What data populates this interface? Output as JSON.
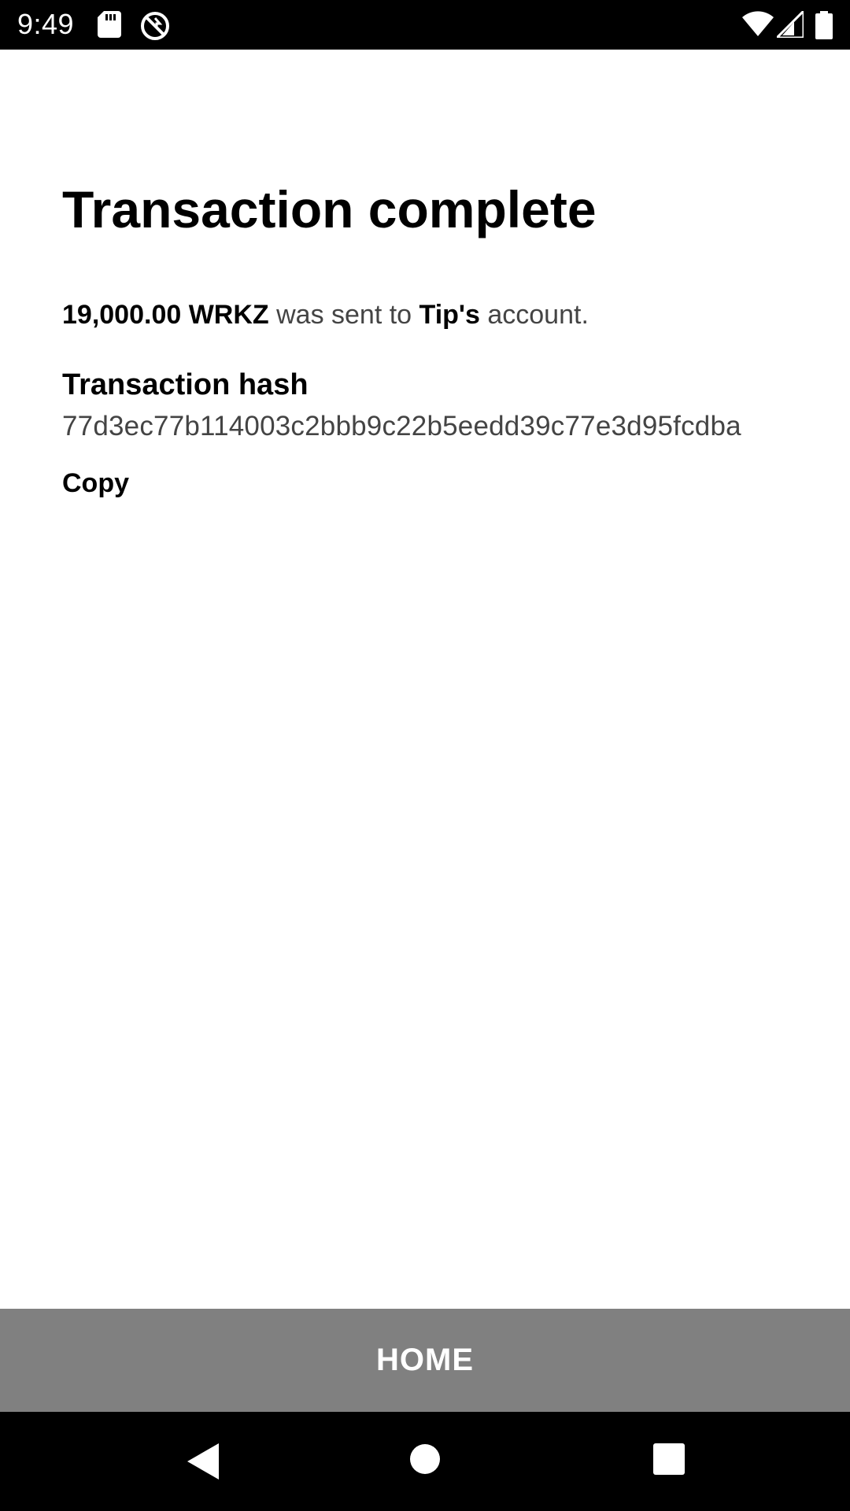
{
  "status_bar": {
    "time": "9:49",
    "icons": [
      "sd-card-icon",
      "data-saver-icon",
      "wifi-icon",
      "signal-icon",
      "battery-icon"
    ]
  },
  "screen": {
    "title": "Transaction complete",
    "message": {
      "amount": "19,000.00 WRKZ",
      "text_middle": " was sent to ",
      "recipient": "Tip's",
      "text_end": " account."
    },
    "hash_label": "Transaction hash",
    "hash_value": "77d3ec77b114003c2bbb9c22b5eedd39c77e3d95fcdba",
    "copy_label": "Copy"
  },
  "footer": {
    "home_label": "HOME"
  },
  "nav_bar": {
    "icons": [
      "back-icon",
      "home-circle-icon",
      "recents-icon"
    ]
  },
  "colors": {
    "home_bar": "#808080",
    "system_bars": "#000000"
  }
}
